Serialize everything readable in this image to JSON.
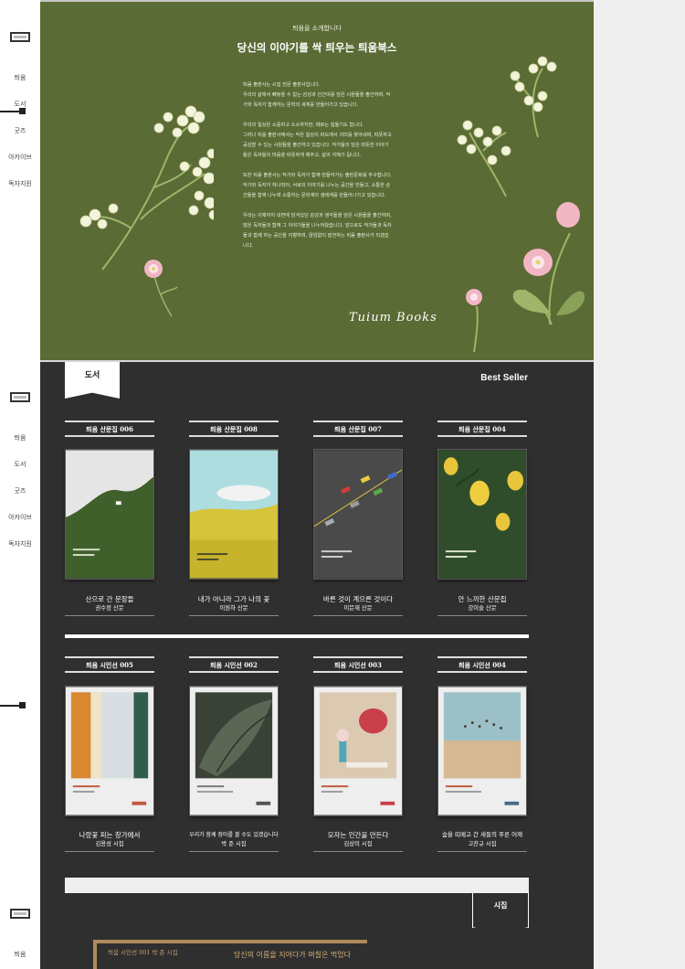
{
  "sidebar": {
    "groups": [
      {
        "items": [
          "틔움",
          "도서",
          "굿즈",
          "아카이브",
          "독자지원"
        ]
      },
      {
        "items": [
          "틔움",
          "도서",
          "굿즈",
          "아카이브",
          "독자지원"
        ]
      },
      {
        "items": [
          "틔움"
        ]
      }
    ]
  },
  "hero": {
    "eyebrow": "틔움을 소개합니다",
    "headline": "당신의 이야기를 싹 틔우는 틔움북스",
    "paragraphs": [
      "틔움 출판사는 시집 전문 출판사입니다.\n우리의 삶에서 빼놓을 수 없는 감성과 인간미를 담은 시원들을 출간하며, 작가와 독자가 함께하는 문학의 세계를 만들어가고 있습니다.",
      "우리의 일상은 소중하고 소소하지만, 때로는 힘들기도 합니다.\n그러나 틔움 출판사에서는 작은 일상의 파도에서 의미를 찾아내며, 따뜻하고 공감할 수 있는 시원들을 출간하고 있습니다. 작가들의 담은 따뜻한 이야기들은 독자들의 마음을 따뜻하게 해주고, 삶의 지혜가 됩니다.",
      "또한 틔움 출판사는 작가와 독자가 함께 만들어가는 출판문화를 추구합니다. 작가와 독자가 하나되어, 서로의 이야기를 나누는 공간을 만들고, 소통한 순간들을 함께 나누며 소통하는 문학계의 생태계를 만들어나가고 있습니다.",
      "우리는 이제까지 내면에 담겨있던 감성과 생각들을 담은 시원들을 출간하며, 많은 독자들과 함께 그 이야기들을 나누어왔습니다. 앞으로도 작가들과 독자들과 함께 하는 공간을 지향하며, 끊임없이 발전하는 틔움 출판사가 되겠습니다."
    ],
    "signature": "Tuium Books"
  },
  "books_section": {
    "tab_label": "도서",
    "best_seller_label": "Best Seller",
    "essays": [
      {
        "series": "틔움 산문집 006",
        "title": "산으로 간 문장들",
        "author": "권수정 산문"
      },
      {
        "series": "틔움 산문집 008",
        "title": "내가 아니라 그가 나의 꽃",
        "author": "이원하 산문"
      },
      {
        "series": "틔움 산문집 007",
        "title": "바른 것이 계으른 것이다",
        "author": "이문재 산문"
      },
      {
        "series": "틔움 산문집 004",
        "title": "안 느끼한 산문집",
        "author": "강이슬 산문"
      }
    ],
    "poems": [
      {
        "series": "틔움 시인선 005",
        "title": "나랑꽃 피는 창가에서",
        "author": "김용성 시집"
      },
      {
        "series": "틔움 시인선 002",
        "title": "우리가 함께 장마를 볼 수도 있겠습니다",
        "author": "박 준 시집"
      },
      {
        "series": "틔움 시인선 003",
        "title": "모자는 인간을 만든다",
        "author": "김상미 시집"
      },
      {
        "series": "틔움 시인선 004",
        "title": "숨을 띠메고 간 새들의 푸른 어깨",
        "author": "고찬규 시집"
      }
    ],
    "poetry_tab_label": "시집",
    "featured": {
      "label": "틔움 시인선 001 박 준 시집",
      "title": "당신의 이름을 지어다가 며칠은 먹었다"
    }
  }
}
